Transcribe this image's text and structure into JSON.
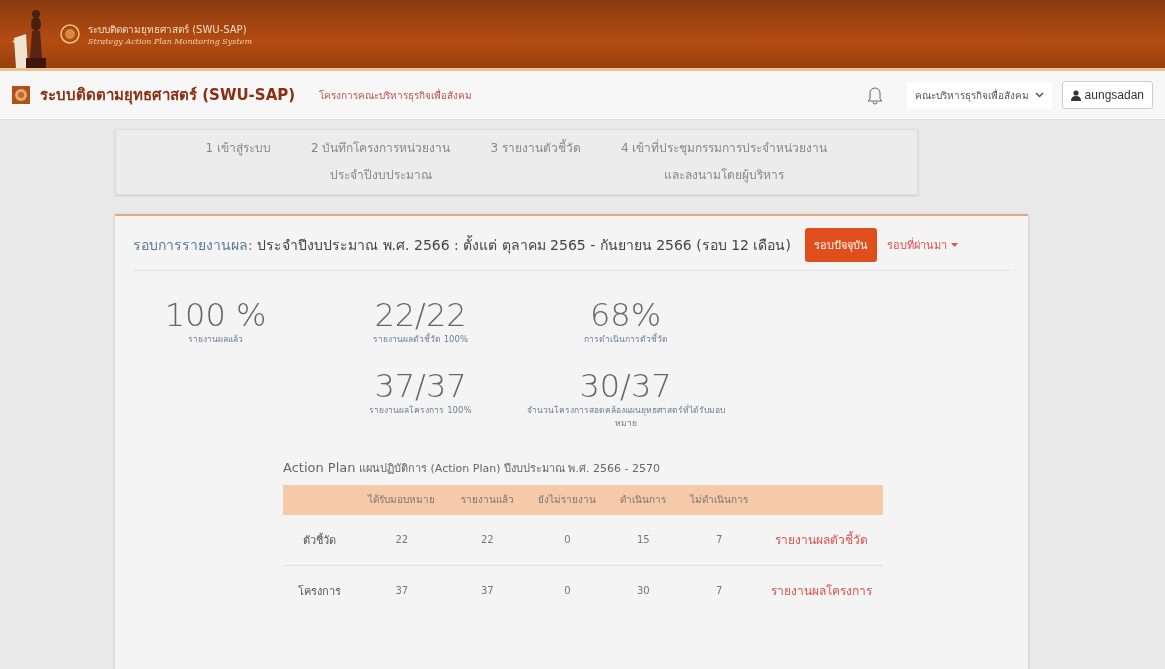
{
  "banner": {
    "title": "ระบบติดตามยุทธศาสตร์ (SWU-SAP)",
    "subtitle": "Strategy Action Plan Monitoring System"
  },
  "navbar": {
    "brand": "ระบบติดตามยุทธศาสตร์ (SWU-SAP)",
    "project": "โครงการคณะบริหารธุรกิจเพื่อสังคม",
    "unit_select": "คณะบริหารธุรกิจเพื่อสังคม",
    "user": "aungsadan"
  },
  "steps": [
    {
      "lines": [
        "1 เข้าสู่ระบบ"
      ]
    },
    {
      "lines": [
        "2 บันทึกโครงการหน่วยงาน",
        "ประจำปีงบประมาณ"
      ]
    },
    {
      "lines": [
        "3 รายงานตัวชี้วัด"
      ]
    },
    {
      "lines": [
        "4 เข้าที่ประชุมกรรมการประจำหน่วยงาน",
        "และลงนามโดยผู้บริหาร"
      ]
    }
  ],
  "report": {
    "heading": "รอบการรายงานผล:",
    "period": "ประจำปีงบประมาณ พ.ศ. 2566 : ตั้งแต่ ตุลาคม 2565 - กันยายน 2566 (รอบ 12 เดือน)",
    "current_button": "รอบปัจจุบัน",
    "past_link": "รอบที่ผ่านมา"
  },
  "stat_rows": [
    [
      {
        "value": "100 %",
        "label": "รายงานผลแล้ว"
      },
      {
        "value": "22/22",
        "label": "รายงานผลตัวชี้วัด 100%"
      },
      {
        "value": "68%",
        "label": "การดำเนินการตัวชี้วัด"
      }
    ],
    [
      {
        "value": "37/37",
        "label": "รายงานผลโครงการ 100%"
      },
      {
        "value": "30/37",
        "label": "จำนวนโครงการสอดคล้องแผนยุทธศาสตร์ที่ได้รับมอบหมาย"
      }
    ]
  ],
  "action_plan": {
    "title": "Action Plan",
    "subtitle": "แผนปฏิบัติการ (Action Plan) ปีงบประมาณ พ.ศ. 2566 - 2570",
    "columns": [
      "ได้รับมอบหมาย",
      "รายงานแล้ว",
      "ยังไม่รายงาน",
      "ดำเนินการ",
      "ไม่ดำเนินการ"
    ],
    "rows": [
      {
        "name": "ตัวชี้วัด",
        "cells": [
          "22",
          "22",
          "0",
          "15",
          "7"
        ],
        "link": "รายงานผลตัวชี้วัด"
      },
      {
        "name": "โครงการ",
        "cells": [
          "37",
          "37",
          "0",
          "30",
          "7"
        ],
        "link": "รายงานผลโครงการ"
      }
    ]
  }
}
